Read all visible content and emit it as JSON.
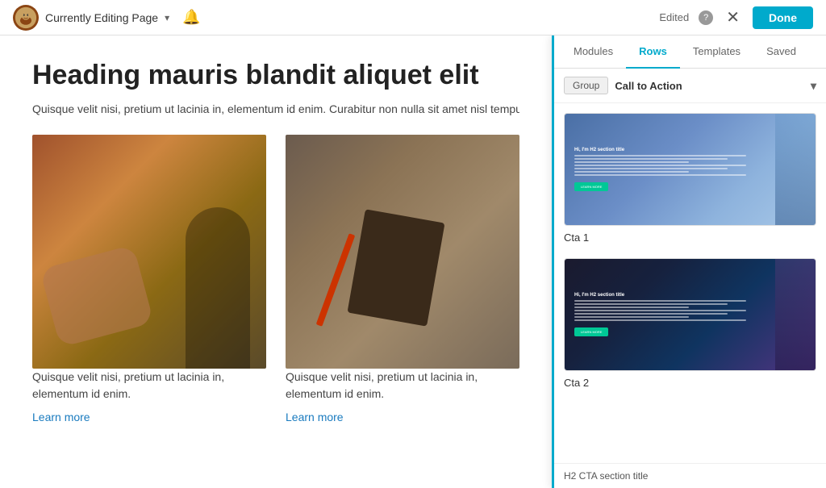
{
  "topbar": {
    "page_title": "Currently Editing Page",
    "edited_label": "Edited",
    "done_label": "Done",
    "help_label": "?"
  },
  "page": {
    "heading": "Heading mauris blandit aliquet elit",
    "subtext": "Quisque velit nisi, pretium ut lacinia in, elementum id enim. Curabitur non nulla sit amet nisl tempus convallis qu",
    "card1": {
      "description": "Quisque velit nisi, pretium ut lacinia in, elementum id enim.",
      "link": "Learn more"
    },
    "card2": {
      "description": "Quisque velit nisi, pretium ut lacinia in, elementum id enim.",
      "link": "Learn more"
    }
  },
  "panel": {
    "tabs": [
      {
        "id": "modules",
        "label": "Modules"
      },
      {
        "id": "rows",
        "label": "Rows"
      },
      {
        "id": "templates",
        "label": "Templates"
      },
      {
        "id": "saved",
        "label": "Saved"
      }
    ],
    "active_tab": "rows",
    "group_label": "Group",
    "filter_value": "Call to Action",
    "templates": [
      {
        "id": "cta1",
        "label": "Cta 1"
      },
      {
        "id": "cta2",
        "label": "Cta 2"
      }
    ],
    "bottom_partial_label": "H2 CTA section title"
  }
}
